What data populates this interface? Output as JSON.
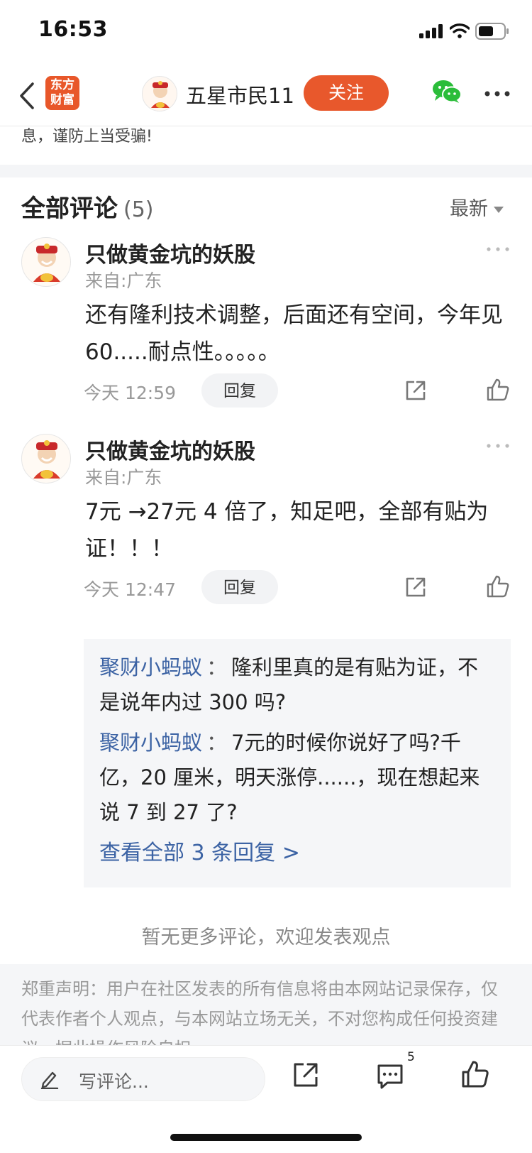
{
  "status_bar": {
    "time": "16:53"
  },
  "header": {
    "logo_line1": "东方",
    "logo_line2": "财富",
    "username": "五星市民11",
    "follow_label": "关注"
  },
  "article_tail": "息，谨防上当受骗!",
  "comments_section": {
    "title": "全部评论",
    "count": "(5)",
    "sort_label": "最新"
  },
  "comments": [
    {
      "name": "只做黄金坑的妖股",
      "origin": "来自:广东",
      "text": "还有隆利技术调整，后面还有空间，今年见 60.....耐点性。。。。。",
      "time": "今天 12:59",
      "reply_label": "回复"
    },
    {
      "name": "只做黄金坑的妖股",
      "origin": "来自:广东",
      "text": "7元 →27元 4 倍了，知足吧，全部有贴为证！！！",
      "time": "今天 12:47",
      "reply_label": "回复"
    }
  ],
  "replies": [
    {
      "user": "聚财小蚂蚁",
      "sep": "：",
      "text": "隆利里真的是有贴为证，不是说年内过 300 吗?"
    },
    {
      "user": "聚财小蚂蚁",
      "sep": "：",
      "text": "7元的时候你说好了吗?千亿，20 厘米，明天涨停......，现在想起来说 7 到 27 了?"
    }
  ],
  "view_all_replies": "查看全部 3 条回复 >",
  "no_more_text": "暂无更多评论，欢迎发表观点",
  "disclaimer": "郑重声明：用户在社区发表的所有信息将由本网站记录保存，仅代表作者个人观点，与本网站立场无关，不对您构成任何投资建议，据此操作风险自担。",
  "bottom_bar": {
    "write_placeholder": "写评论...",
    "comment_count": "5"
  },
  "colors": {
    "accent": "#e8582c",
    "link": "#3c63a4",
    "wechat": "#2bbd3a"
  },
  "icons": [
    "back-arrow-icon",
    "signal-icon",
    "wifi-icon",
    "battery-icon",
    "wechat-icon",
    "more-icon",
    "share-icon",
    "like-icon",
    "pen-icon",
    "comment-icon"
  ]
}
